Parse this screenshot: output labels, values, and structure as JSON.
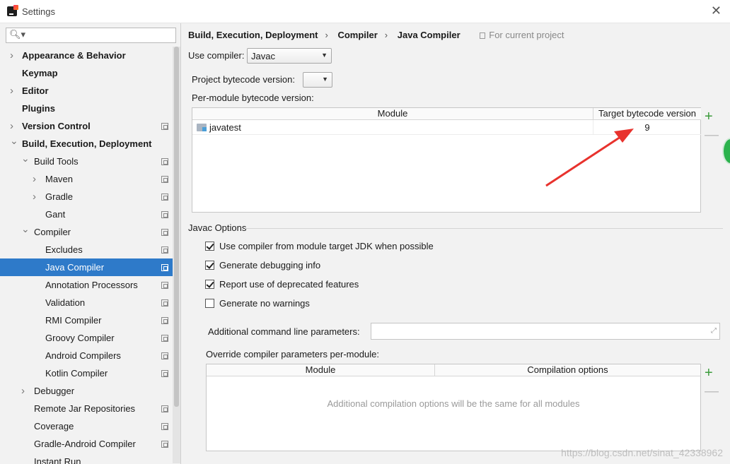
{
  "window": {
    "title": "Settings"
  },
  "search": {
    "placeholder": ""
  },
  "sidebar": {
    "items": [
      {
        "label": "Appearance & Behavior",
        "level": 0,
        "arrow": "collapsed",
        "bold": true,
        "project": false
      },
      {
        "label": "Keymap",
        "level": 0,
        "arrow": "none",
        "bold": true,
        "project": false
      },
      {
        "label": "Editor",
        "level": 0,
        "arrow": "collapsed",
        "bold": true,
        "project": false
      },
      {
        "label": "Plugins",
        "level": 0,
        "arrow": "none",
        "bold": true,
        "project": false
      },
      {
        "label": "Version Control",
        "level": 0,
        "arrow": "collapsed",
        "bold": true,
        "project": true
      },
      {
        "label": "Build, Execution, Deployment",
        "level": 0,
        "arrow": "expanded",
        "bold": true,
        "project": false
      },
      {
        "label": "Build Tools",
        "level": 1,
        "arrow": "expanded",
        "bold": false,
        "project": true
      },
      {
        "label": "Maven",
        "level": 2,
        "arrow": "collapsed",
        "bold": false,
        "project": true
      },
      {
        "label": "Gradle",
        "level": 2,
        "arrow": "collapsed",
        "bold": false,
        "project": true
      },
      {
        "label": "Gant",
        "level": 2,
        "arrow": "none",
        "bold": false,
        "project": true
      },
      {
        "label": "Compiler",
        "level": 1,
        "arrow": "expanded",
        "bold": false,
        "project": true
      },
      {
        "label": "Excludes",
        "level": 2,
        "arrow": "none",
        "bold": false,
        "project": true
      },
      {
        "label": "Java Compiler",
        "level": 2,
        "arrow": "none",
        "bold": false,
        "project": true,
        "selected": true
      },
      {
        "label": "Annotation Processors",
        "level": 2,
        "arrow": "none",
        "bold": false,
        "project": true
      },
      {
        "label": "Validation",
        "level": 2,
        "arrow": "none",
        "bold": false,
        "project": true
      },
      {
        "label": "RMI Compiler",
        "level": 2,
        "arrow": "none",
        "bold": false,
        "project": true
      },
      {
        "label": "Groovy Compiler",
        "level": 2,
        "arrow": "none",
        "bold": false,
        "project": true
      },
      {
        "label": "Android Compilers",
        "level": 2,
        "arrow": "none",
        "bold": false,
        "project": true
      },
      {
        "label": "Kotlin Compiler",
        "level": 2,
        "arrow": "none",
        "bold": false,
        "project": true
      },
      {
        "label": "Debugger",
        "level": 1,
        "arrow": "collapsed",
        "bold": false,
        "project": false
      },
      {
        "label": "Remote Jar Repositories",
        "level": 1,
        "arrow": "none",
        "bold": false,
        "project": true
      },
      {
        "label": "Coverage",
        "level": 1,
        "arrow": "none",
        "bold": false,
        "project": true
      },
      {
        "label": "Gradle-Android Compiler",
        "level": 1,
        "arrow": "none",
        "bold": false,
        "project": true
      },
      {
        "label": "Instant Run",
        "level": 1,
        "arrow": "none",
        "bold": false,
        "project": false
      }
    ]
  },
  "breadcrumb": {
    "part1": "Build, Execution, Deployment",
    "part2": "Compiler",
    "part3": "Java Compiler",
    "separator": "›",
    "scope": "For current project"
  },
  "compiler": {
    "label": "Use compiler:",
    "value": "Javac"
  },
  "bytecode": {
    "label": "Project bytecode version:",
    "value": ""
  },
  "per_module": {
    "label": "Per-module bytecode version:",
    "col_module": "Module",
    "col_target": "Target bytecode version",
    "rows": [
      {
        "module": "javatest",
        "target": "9"
      }
    ]
  },
  "javac": {
    "title": "Javac Options",
    "options": [
      {
        "label": "Use compiler from module target JDK when possible",
        "checked": true
      },
      {
        "label": "Generate debugging info",
        "checked": true
      },
      {
        "label": "Report use of deprecated features",
        "checked": true
      },
      {
        "label": "Generate no warnings",
        "checked": false
      }
    ],
    "additional_label": "Additional command line parameters:",
    "additional_value": ""
  },
  "override": {
    "label": "Override compiler parameters per-module:",
    "col_module": "Module",
    "col_options": "Compilation options",
    "empty_text": "Additional compilation options will be the same for all modules"
  },
  "buttons": {
    "add": "+",
    "remove": "—"
  },
  "watermark": "https://blog.csdn.net/sinat_42338962",
  "colors": {
    "selection": "#2e7ac9",
    "annotation_arrow": "#e8322d",
    "add_green": "#3a9b3a"
  }
}
